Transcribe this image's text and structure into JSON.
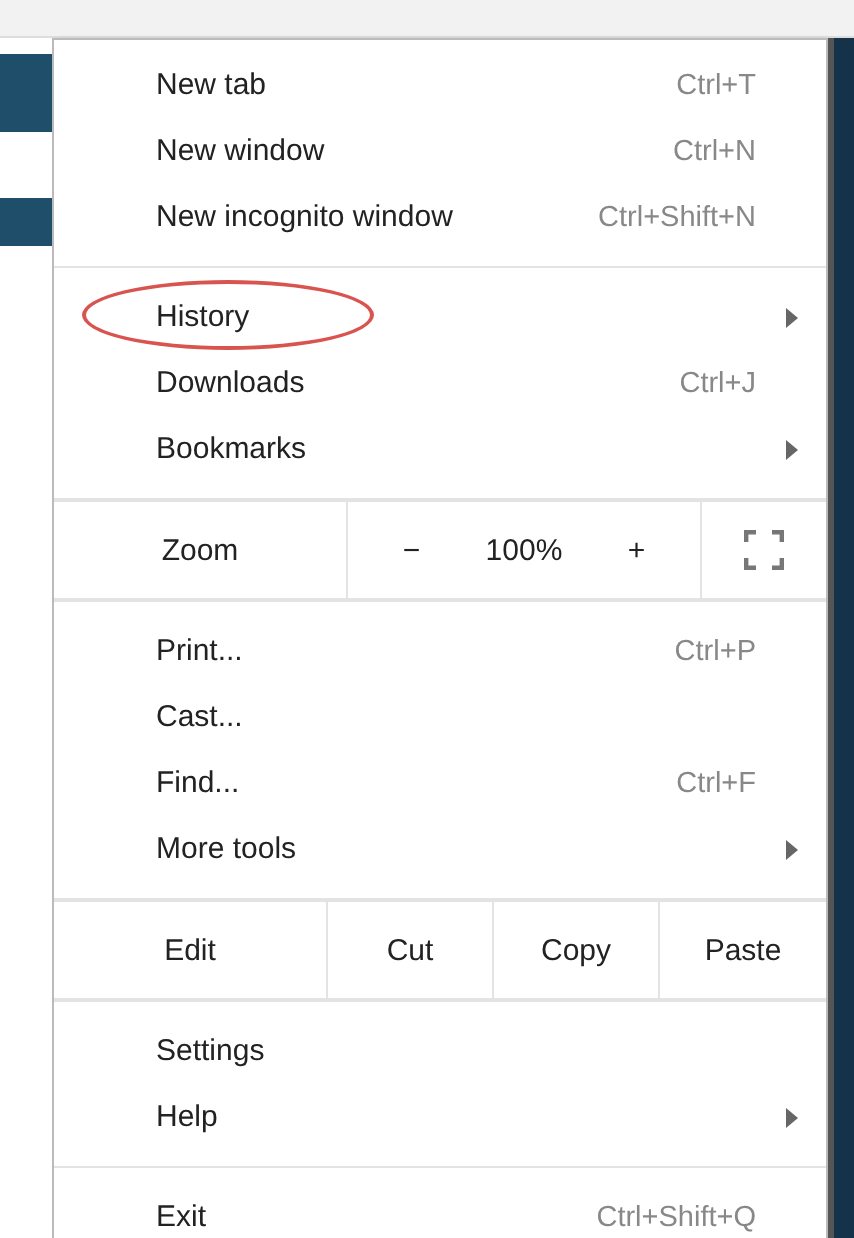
{
  "menu": {
    "sections": [
      [
        {
          "kind": "item",
          "label": "New tab",
          "shortcut": "Ctrl+T"
        },
        {
          "kind": "item",
          "label": "New window",
          "shortcut": "Ctrl+N"
        },
        {
          "kind": "item",
          "label": "New incognito window",
          "shortcut": "Ctrl+Shift+N"
        }
      ],
      [
        {
          "kind": "item",
          "label": "History",
          "submenu": true,
          "circled": true
        },
        {
          "kind": "item",
          "label": "Downloads",
          "shortcut": "Ctrl+J"
        },
        {
          "kind": "item",
          "label": "Bookmarks",
          "submenu": true
        }
      ],
      [
        {
          "kind": "zoom",
          "label": "Zoom",
          "minus": "−",
          "value": "100%",
          "plus": "+"
        }
      ],
      [
        {
          "kind": "item",
          "label": "Print...",
          "shortcut": "Ctrl+P"
        },
        {
          "kind": "item",
          "label": "Cast..."
        },
        {
          "kind": "item",
          "label": "Find...",
          "shortcut": "Ctrl+F"
        },
        {
          "kind": "item",
          "label": "More tools",
          "submenu": true
        }
      ],
      [
        {
          "kind": "edit",
          "label": "Edit",
          "buttons": [
            "Cut",
            "Copy",
            "Paste"
          ]
        }
      ],
      [
        {
          "kind": "item",
          "label": "Settings"
        },
        {
          "kind": "item",
          "label": "Help",
          "submenu": true
        }
      ],
      [
        {
          "kind": "item",
          "label": "Exit",
          "shortcut": "Ctrl+Shift+Q"
        }
      ]
    ]
  }
}
